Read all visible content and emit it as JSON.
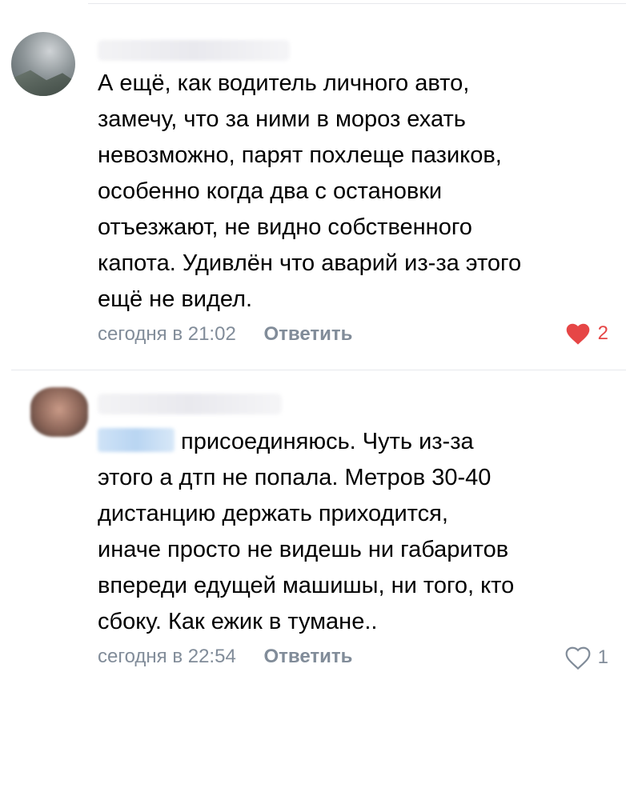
{
  "comments": [
    {
      "text": "А ещё, как водитель личного авто,\nзамечу, что за ними в мороз ехать\nневозможно, парят похлеще пазиков,\nособенно когда два с остановки\nотъезжают, не видно собственного\nкапота. Удивлён что аварий из-за этого\nещё не видел.",
      "time": "сегодня в 21:02",
      "reply_label": "Ответить",
      "likes": "2",
      "liked": true,
      "like_icon": "heart-filled-icon",
      "like_color": "#e64646"
    },
    {
      "text": "присоединяюсь. Чуть из-за\nэтого а дтп не попала. Метров 30-40\nдистанцию держать приходится,\nиначе просто не видешь ни габаритов\nвпереди едущей машишы, ни того, кто\nсбоку. Как ежик в тумане..",
      "time": "сегодня в 22:54",
      "reply_label": "Ответить",
      "likes": "1",
      "liked": false,
      "like_icon": "heart-outline-icon",
      "like_color": "#818c99"
    }
  ],
  "colors": {
    "text": "#000000",
    "meta": "#818c99",
    "divider": "#e7e8ec"
  }
}
